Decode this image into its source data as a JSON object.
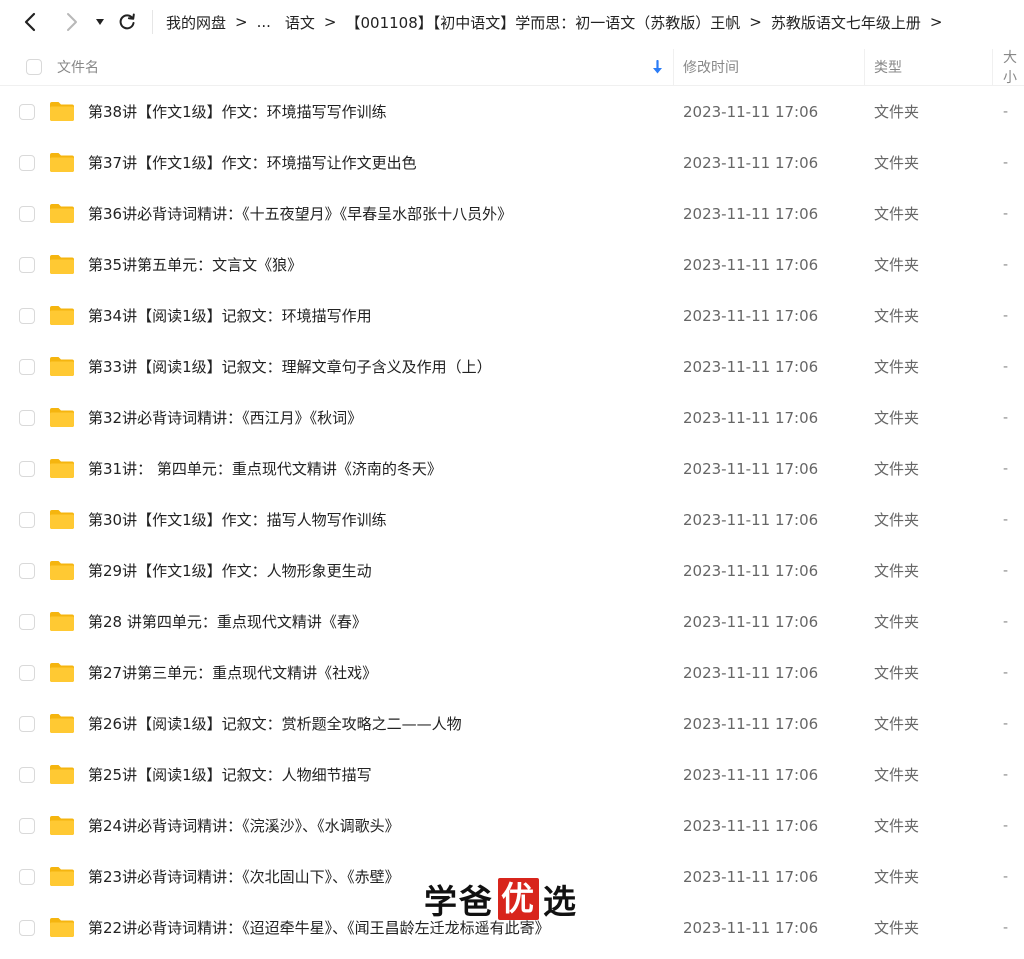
{
  "nav": {
    "back_icon": "chevron-left-icon",
    "forward_icon": "chevron-right-icon",
    "history_icon": "caret-down-icon",
    "refresh_icon": "refresh-icon"
  },
  "breadcrumb": [
    "我的网盘",
    "...",
    "语文",
    "【001108】【初中语文】学而思：初一语文（苏教版）王帆",
    "苏教版语文七年级上册"
  ],
  "breadcrumb_separator": ">",
  "columns": {
    "name": "文件名",
    "modified": "修改时间",
    "type": "类型",
    "size": "大小"
  },
  "sort_indicator": "⬇",
  "files": [
    {
      "name": "第38讲【作文1级】作文：环境描写写作训练",
      "modified": "2023-11-11 17:06",
      "type": "文件夹",
      "size": "-"
    },
    {
      "name": "第37讲【作文1级】作文：环境描写让作文更出色",
      "modified": "2023-11-11 17:06",
      "type": "文件夹",
      "size": "-"
    },
    {
      "name": "第36讲必背诗词精讲：《十五夜望月》《早春呈水部张十八员外》",
      "modified": "2023-11-11 17:06",
      "type": "文件夹",
      "size": "-"
    },
    {
      "name": "第35讲第五单元：文言文《狼》",
      "modified": "2023-11-11 17:06",
      "type": "文件夹",
      "size": "-"
    },
    {
      "name": "第34讲【阅读1级】记叙文：环境描写作用",
      "modified": "2023-11-11 17:06",
      "type": "文件夹",
      "size": "-"
    },
    {
      "name": "第33讲【阅读1级】记叙文：理解文章句子含义及作用（上）",
      "modified": "2023-11-11 17:06",
      "type": "文件夹",
      "size": "-"
    },
    {
      "name": "第32讲必背诗词精讲：《西江月》《秋词》",
      "modified": "2023-11-11 17:06",
      "type": "文件夹",
      "size": "-"
    },
    {
      "name": "第31讲：  第四单元：重点现代文精讲《济南的冬天》",
      "modified": "2023-11-11 17:06",
      "type": "文件夹",
      "size": "-"
    },
    {
      "name": "第30讲【作文1级】作文：描写人物写作训练",
      "modified": "2023-11-11 17:06",
      "type": "文件夹",
      "size": "-"
    },
    {
      "name": "第29讲【作文1级】作文：人物形象更生动",
      "modified": "2023-11-11 17:06",
      "type": "文件夹",
      "size": "-"
    },
    {
      "name": "第28 讲第四单元：重点现代文精讲《春》",
      "modified": "2023-11-11 17:06",
      "type": "文件夹",
      "size": "-"
    },
    {
      "name": "第27讲第三单元：重点现代文精讲《社戏》",
      "modified": "2023-11-11 17:06",
      "type": "文件夹",
      "size": "-"
    },
    {
      "name": "第26讲【阅读1级】记叙文：赏析题全攻略之二——人物",
      "modified": "2023-11-11 17:06",
      "type": "文件夹",
      "size": "-"
    },
    {
      "name": "第25讲【阅读1级】记叙文：人物细节描写",
      "modified": "2023-11-11 17:06",
      "type": "文件夹",
      "size": "-"
    },
    {
      "name": "第24讲必背诗词精讲：《浣溪沙》、《水调歌头》",
      "modified": "2023-11-11 17:06",
      "type": "文件夹",
      "size": "-"
    },
    {
      "name": "第23讲必背诗词精讲：《次北固山下》、《赤壁》",
      "modified": "2023-11-11 17:06",
      "type": "文件夹",
      "size": "-"
    },
    {
      "name": "第22讲必背诗词精讲：《迢迢牵牛星》、《闻王昌龄左迁龙标遥有此寄》",
      "modified": "2023-11-11 17:06",
      "type": "文件夹",
      "size": "-"
    }
  ],
  "watermark": {
    "part1": "学爸",
    "badge": "优",
    "part2": "选"
  },
  "colors": {
    "folder": "#FFC933",
    "sort_arrow": "#2B7CF6",
    "watermark_badge": "#D8251C"
  }
}
